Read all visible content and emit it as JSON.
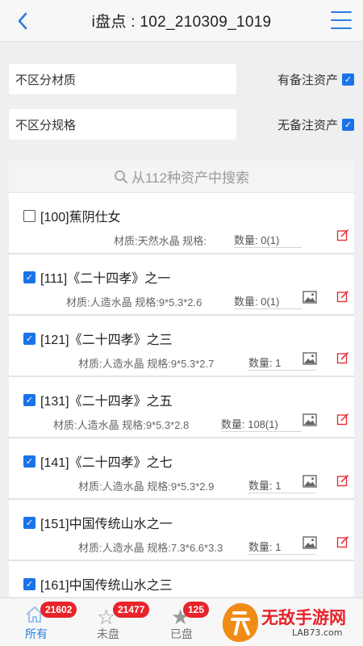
{
  "header": {
    "title": "i盘点 : 102_210309_1019",
    "back_icon": "chevron-left-icon",
    "menu_icon": "hamburger-menu-icon"
  },
  "filters": [
    {
      "select": "不区分材质",
      "check_label": "有备注资产",
      "checked": true
    },
    {
      "select": "不区分规格",
      "check_label": "无备注资产",
      "checked": true
    }
  ],
  "search": {
    "placeholder": "从112种资产中搜索"
  },
  "items": [
    {
      "checked": false,
      "name": "[100]蕉阴仕女",
      "spec": "材质:天然水晶 规格:",
      "qty": "数量: 0(1)",
      "has_image": false
    },
    {
      "checked": true,
      "name": "[111]《二十四孝》之一",
      "spec": "材质:人造水晶 规格:9*5.3*2.6",
      "qty": "数量: 0(1)",
      "has_image": true
    },
    {
      "checked": true,
      "name": "[121]《二十四孝》之三",
      "spec": "材质:人造水晶 规格:9*5.3*2.7",
      "qty": "数量: 1",
      "has_image": true
    },
    {
      "checked": true,
      "name": "[131]《二十四孝》之五",
      "spec": "材质:人造水晶 规格:9*5.3*2.8",
      "qty": "数量: 108(1)",
      "has_image": true
    },
    {
      "checked": true,
      "name": "[141]《二十四孝》之七",
      "spec": "材质:人造水晶 规格:9*5.3*2.9",
      "qty": "数量: 1",
      "has_image": true
    },
    {
      "checked": true,
      "name": "[151]中国传统山水之一",
      "spec": "材质:人造水晶 规格:7.3*6.6*3.3",
      "qty": "数量: 1",
      "has_image": true
    },
    {
      "checked": true,
      "name": "[161]中国传统山水之三",
      "spec": "",
      "qty": "",
      "has_image": false
    }
  ],
  "tabs": [
    {
      "label": "所有",
      "badge": "21602",
      "icon": "home-icon",
      "active": true
    },
    {
      "label": "未盘",
      "badge": "21477",
      "icon": "star-outline-icon",
      "active": false
    },
    {
      "label": "已盘",
      "badge": "125",
      "icon": "star-filled-icon",
      "active": false
    }
  ],
  "watermark": {
    "text": "无敌手游网",
    "url": "LAB73.com"
  },
  "colors": {
    "accent": "#2b7de0",
    "badge": "#e8232a",
    "edit": "#e8232a"
  }
}
